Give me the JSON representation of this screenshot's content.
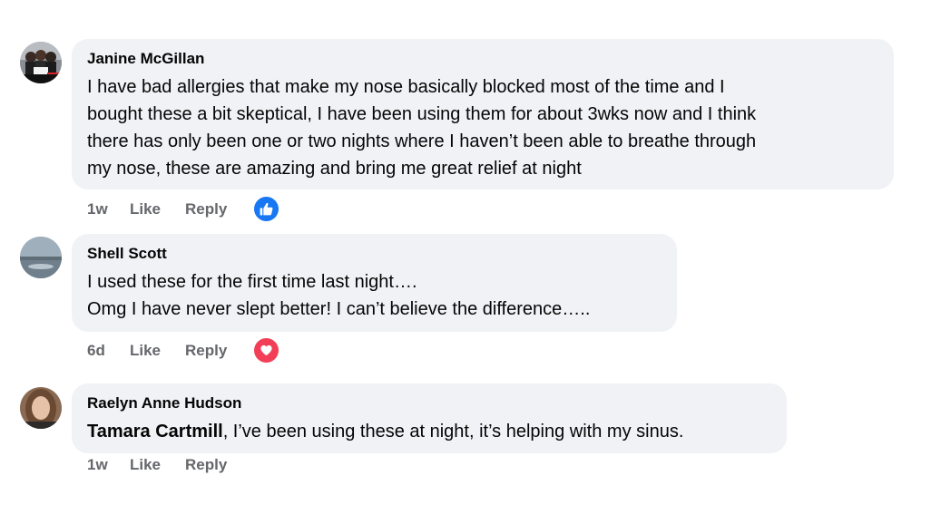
{
  "comments": [
    {
      "author": "Janine McGillan",
      "lines": [
        "I have bad allergies that make my nose basically blocked most of the time and I",
        "bought these a bit skeptical, I have been using them for about 3wks now and I think",
        "there has only been one or two nights where I haven’t been able to breathe through",
        "my nose, these are amazing and bring me great relief at night"
      ],
      "time": "1w",
      "like_label": "Like",
      "reply_label": "Reply",
      "reaction": "like-reaction-icon",
      "reaction_color": "#1877f2"
    },
    {
      "author": "Shell Scott",
      "lines": [
        "I used these for the first time last night….",
        "Omg I have never slept better! I can’t believe the difference….."
      ],
      "time": "6d",
      "like_label": "Like",
      "reply_label": "Reply",
      "reaction": "love-reaction-icon",
      "reaction_color": "#f33e58"
    },
    {
      "author": "Raelyn Anne Hudson",
      "mention": "Tamara Cartmill",
      "text_after_mention": ", I’ve been using these at night, it’s helping with my sinus.",
      "time": "1w",
      "like_label": "Like",
      "reply_label": "Reply"
    }
  ]
}
